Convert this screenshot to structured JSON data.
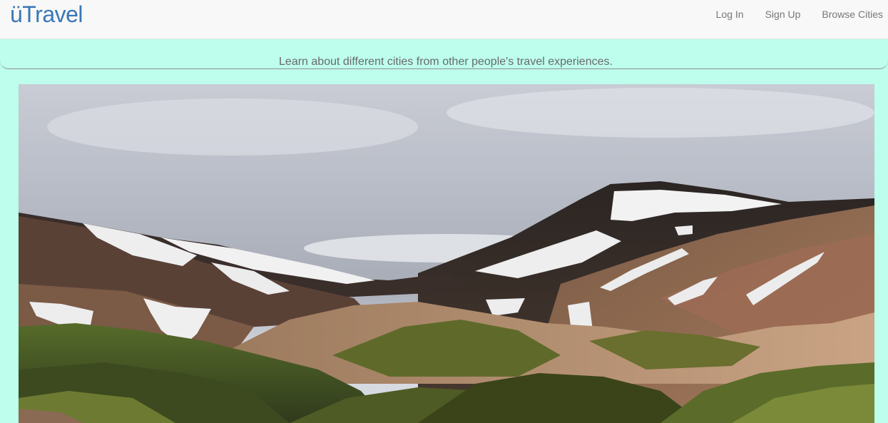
{
  "navbar": {
    "brand": "üTravel",
    "links": [
      {
        "label": "Log In"
      },
      {
        "label": "Sign Up"
      },
      {
        "label": "Browse Cities"
      }
    ]
  },
  "hero": {
    "tagline": "Learn about different cities from other people's travel experiences.",
    "image_subject": "mountain-landscape-photo"
  },
  "colors": {
    "background": "#bdfeec",
    "navbar": "#f8f8f8",
    "brand": "#3a77b6",
    "nav_text": "#777777"
  }
}
